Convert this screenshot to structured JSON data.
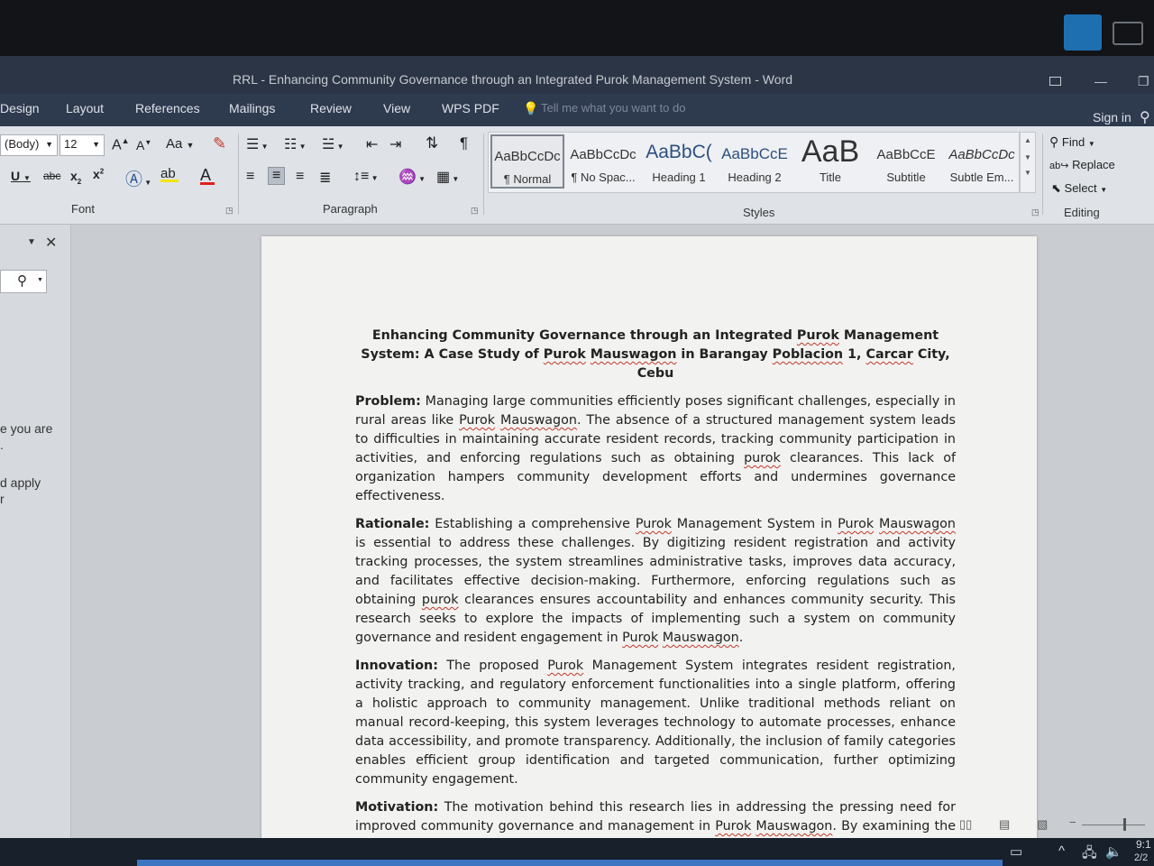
{
  "window": {
    "title": "RRL - Enhancing Community Governance through an Integrated Purok Management System - Word",
    "restore_icon": "window-restore-icon",
    "minimize_glyph": "—",
    "maximize_glyph": "❐"
  },
  "tabs": [
    "Design",
    "Layout",
    "References",
    "Mailings",
    "Review",
    "View",
    "WPS PDF"
  ],
  "tell_me": "Tell me what you want to do",
  "sign_in": "Sign in",
  "font_group": {
    "label": "Font",
    "font_name": "(Body)",
    "font_size": "12",
    "grow": "A",
    "shrink": "A",
    "case": "Aa",
    "underline": "U",
    "strikethrough": "abc",
    "subscript": "x",
    "superscript": "x"
  },
  "paragraph_group": {
    "label": "Paragraph"
  },
  "styles_group": {
    "label": "Styles",
    "styles": [
      {
        "sample": "AaBbCcDc",
        "name": "¶ Normal",
        "kind": "normal",
        "active": true
      },
      {
        "sample": "AaBbCcDc",
        "name": "¶ No Spac...",
        "kind": "normal",
        "active": false
      },
      {
        "sample": "AaBbC(",
        "name": "Heading 1",
        "kind": "h1",
        "active": false
      },
      {
        "sample": "AaBbCcE",
        "name": "Heading 2",
        "kind": "h2",
        "active": false
      },
      {
        "sample": "AaB",
        "name": "Title",
        "kind": "big",
        "active": false
      },
      {
        "sample": "AaBbCcE",
        "name": "Subtitle",
        "kind": "normal",
        "active": false
      },
      {
        "sample": "AaBbCcDc",
        "name": "Subtle Em...",
        "kind": "normal",
        "active": false
      }
    ]
  },
  "editing_group": {
    "label": "Editing",
    "find": "Find",
    "replace": "Replace",
    "select": "Select"
  },
  "nav_pane": {
    "snippet_1": "e you are",
    "snippet_1b": ".",
    "snippet_2": "d apply",
    "snippet_2b": "r"
  },
  "document": {
    "title": "Enhancing Community Governance through an Integrated Purok Management System: A Case Study of Purok Mauswagon in Barangay Poblacion 1, Carcar City, Cebu",
    "paragraphs": [
      {
        "lead": "Problem:",
        "text": " Managing large communities efficiently poses significant challenges, especially in rural areas like Purok Mauswagon. The absence of a structured management system leads to difficulties in maintaining accurate resident records, tracking community participation in activities, and enforcing regulations such as obtaining purok clearances. This lack of organization hampers community development efforts and undermines governance effectiveness."
      },
      {
        "lead": "Rationale:",
        "text": " Establishing a comprehensive Purok Management System in Purok Mauswagon is essential to address these challenges. By digitizing resident registration and activity tracking processes, the system streamlines administrative tasks, improves data accuracy, and facilitates effective decision-making. Furthermore, enforcing regulations such as obtaining purok clearances ensures accountability and enhances community security. This research seeks to explore the impacts of implementing such a system on community governance and resident engagement in Purok Mauswagon."
      },
      {
        "lead": "Innovation:",
        "text": " The proposed Purok Management System integrates resident registration, activity tracking, and regulatory enforcement functionalities into a single platform, offering a holistic approach to community management. Unlike traditional methods reliant on manual record-keeping, this system leverages technology to automate processes, enhance data accessibility, and promote transparency. Additionally, the inclusion of family categories enables efficient group identification and targeted communication, further optimizing community engagement."
      },
      {
        "lead": "Motivation:",
        "text": " The motivation behind this research lies in addressing the pressing need for improved community governance and management in Purok Mauswagon. By examining the implementation of a Purok Management System, this study aims to generate insights into its efficacy, challenges, and potential for scalability. Ultimately, the findings will contribute to the"
      }
    ]
  },
  "taskbar": {
    "time": "9:1",
    "date": "2/2"
  }
}
